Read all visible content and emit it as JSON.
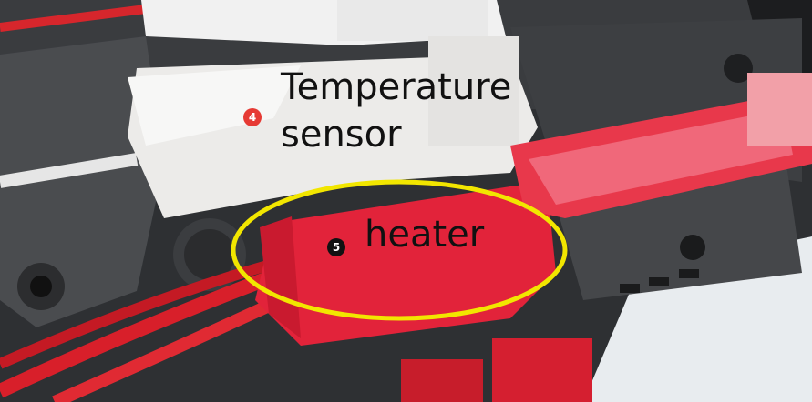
{
  "annotations": [
    {
      "number": "4",
      "label_line1": "Temperature",
      "label_line2": "sensor",
      "badge_color": "#e63a34"
    },
    {
      "number": "5",
      "label": "heater",
      "badge_color": "#111111"
    }
  ],
  "highlight_color": "#f2e600"
}
